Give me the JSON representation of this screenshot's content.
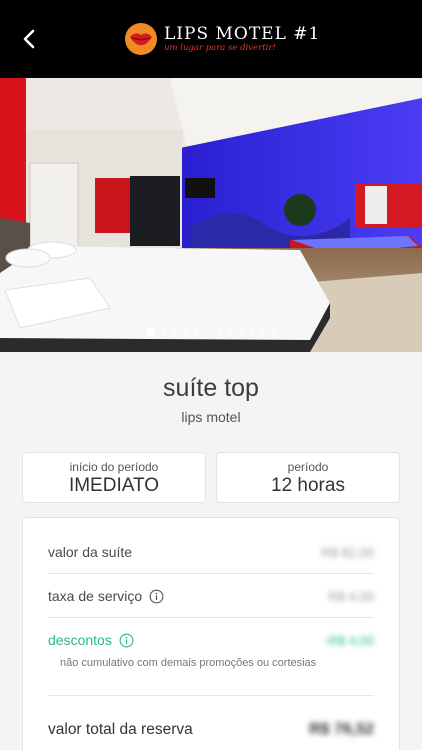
{
  "header": {
    "logo_name": "LIPS MOTEL #1",
    "logo_tagline": "um lugar para se divertir!",
    "accent_color": "#e8322a"
  },
  "gallery": {
    "image_count": 12,
    "active_index": 0
  },
  "suite": {
    "name": "suíte top",
    "motel": "lips motel"
  },
  "period": {
    "start_label": "início do período",
    "start_value": "IMEDIATO",
    "duration_label": "período",
    "duration_value": "12 horas"
  },
  "pricing": {
    "suite_label": "valor da suíte",
    "suite_value": "R$ 82,00",
    "service_label": "taxa de serviço",
    "service_value": "R$ 4,00",
    "discount_label": "descontos",
    "discount_value": "-R$ 4,00",
    "discount_note": "não cumulativo com demais promoções ou cortesias",
    "total_label": "valor total da reserva",
    "total_value": "R$ 76,52",
    "discount_color": "#27b98a"
  }
}
